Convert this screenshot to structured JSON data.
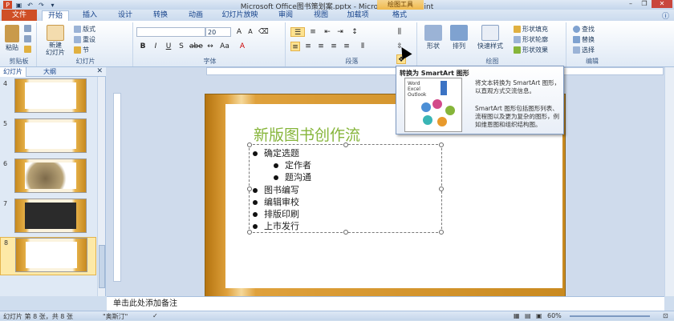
{
  "window": {
    "title": "Microsoft Office图书策划案.pptx - Microsoft PowerPoint",
    "context_tab": "绘图工具",
    "minimize": "–",
    "restore": "❐",
    "close": "✕"
  },
  "ribbon_tabs": {
    "file": "文件",
    "tabs": [
      "开始",
      "插入",
      "设计",
      "转换",
      "动画",
      "幻灯片放映",
      "审阅",
      "视图",
      "加载项",
      "格式"
    ]
  },
  "groups": {
    "clipboard": {
      "label": "剪贴板",
      "paste": "粘贴"
    },
    "slides": {
      "label": "幻灯片",
      "new_slide": "新建\n幻灯片",
      "layout": "版式",
      "reset": "重设",
      "section": "节"
    },
    "font": {
      "label": "字体",
      "font_name": "",
      "font_size": "20"
    },
    "paragraph": {
      "label": "段落"
    },
    "drawing": {
      "label": "绘图",
      "shapes": "形状",
      "arrange": "排列",
      "quick_styles": "快速样式",
      "fill": "形状填充",
      "outline": "形状轮廓",
      "effects": "形状效果"
    },
    "editing": {
      "label": "编辑",
      "find": "查找",
      "replace": "替换",
      "select": "选择"
    }
  },
  "sidebar": {
    "tab_slides": "幻灯片",
    "tab_outline": "大纲",
    "close": "✕",
    "slides": [
      {
        "num": "4"
      },
      {
        "num": "5"
      },
      {
        "num": "6"
      },
      {
        "num": "7"
      },
      {
        "num": "8"
      }
    ]
  },
  "slide": {
    "title": "新版图书创作流",
    "bullets": [
      {
        "text": "确定选题",
        "level": 1
      },
      {
        "text": "定作者",
        "level": 2
      },
      {
        "text": "题沟通",
        "level": 2
      },
      {
        "text": "图书编写",
        "level": 1
      },
      {
        "text": "编辑审校",
        "level": 1
      },
      {
        "text": "排版印刷",
        "level": 1
      },
      {
        "text": "上市发行",
        "level": 1
      }
    ]
  },
  "notes": {
    "placeholder": "单击此处添加备注"
  },
  "tooltip": {
    "title": "转换为 SmartArt 图形",
    "list_items": [
      "Word",
      "Excel",
      "Outlook"
    ],
    "desc1": "将文本转换为 SmartArt 图形，以直观方式交流信息。",
    "desc2": "SmartArt 图形包括图形列表、流程图以及更为复杂的图形，例如维恩图和组织结构图。"
  },
  "statusbar": {
    "slide_info": "幻灯片 第 8 张，共 8 张",
    "theme": "\"奥斯汀\"",
    "zoom": "60%"
  },
  "colors": {
    "file_tab": "#cf4f26",
    "title_green": "#86b53a",
    "context_tab": "#efb94c"
  }
}
